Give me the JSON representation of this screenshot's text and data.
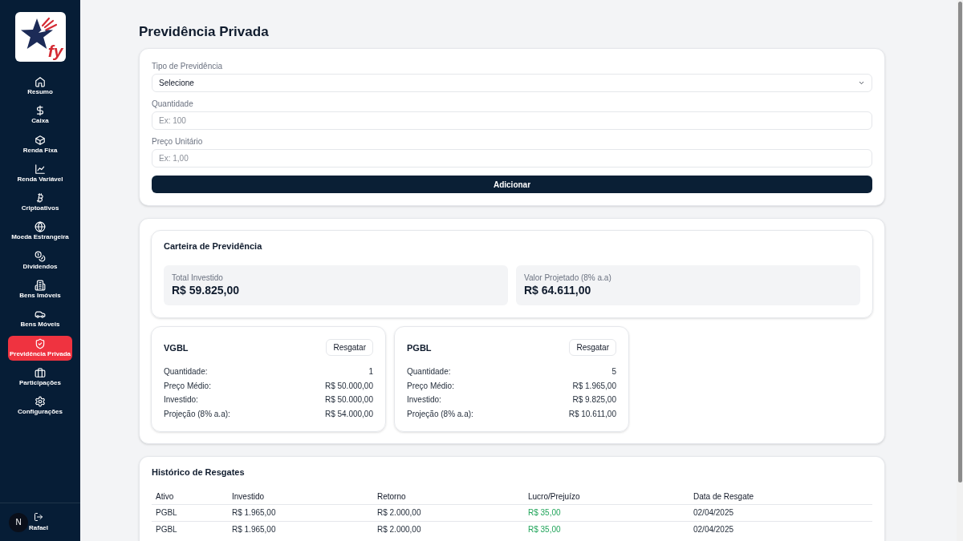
{
  "sidebar": {
    "logo": {
      "text": "fy"
    },
    "items": [
      {
        "label": "Resumo",
        "selected": false
      },
      {
        "label": "Caixa",
        "selected": false
      },
      {
        "label": "Renda Fixa",
        "selected": false
      },
      {
        "label": "Renda Variável",
        "selected": false
      },
      {
        "label": "Criptoativos",
        "selected": false
      },
      {
        "label": "Moeda Estrangeira",
        "selected": false
      },
      {
        "label": "Dividendos",
        "selected": false
      },
      {
        "label": "Bens Imóveis",
        "selected": false
      },
      {
        "label": "Bens Móveis",
        "selected": false
      },
      {
        "label": "Previdência Privada",
        "selected": true
      },
      {
        "label": "Participações",
        "selected": false
      },
      {
        "label": "Configurações",
        "selected": false
      }
    ],
    "footer": {
      "badge": "N",
      "user": "Rafael"
    }
  },
  "page": {
    "title": "Previdência Privada"
  },
  "form": {
    "fields": [
      {
        "kind": "select",
        "label": "Tipo de Previdência",
        "value": "Selecione"
      },
      {
        "kind": "input",
        "label": "Quantidade",
        "placeholder": "Ex: 100"
      },
      {
        "kind": "input",
        "label": "Preço Unitário",
        "placeholder": "Ex: 1,00"
      }
    ],
    "submit": "Adicionar"
  },
  "portfolio": {
    "title": "Carteira de Previdência",
    "stats": [
      {
        "label": "Total Investido",
        "value": "R$ 59.825,00"
      },
      {
        "label": "Valor Projetado (8% a.a)",
        "value": "R$ 64.611,00"
      }
    ],
    "plans": [
      {
        "name": "VGBL",
        "action": "Resgatar",
        "rows": [
          {
            "label": "Quantidade:",
            "value": "1"
          },
          {
            "label": "Preço Médio:",
            "value": "R$ 50.000,00"
          },
          {
            "label": "Investido:",
            "value": "R$ 50.000,00"
          },
          {
            "label": "Projeção (8% a.a):",
            "value": "R$ 54.000,00"
          }
        ]
      },
      {
        "name": "PGBL",
        "action": "Resgatar",
        "rows": [
          {
            "label": "Quantidade:",
            "value": "5"
          },
          {
            "label": "Preço Médio:",
            "value": "R$ 1.965,00"
          },
          {
            "label": "Investido:",
            "value": "R$ 9.825,00"
          },
          {
            "label": "Projeção (8% a.a):",
            "value": "R$ 10.611,00"
          }
        ]
      }
    ]
  },
  "history": {
    "title": "Histórico de Resgates",
    "columns": [
      "Ativo",
      "Investido",
      "Retorno",
      "Lucro/Prejuízo",
      "Data de Resgate"
    ],
    "rows": [
      {
        "asset": "PGBL",
        "invested": "R$ 1.965,00",
        "return": "R$ 2.000,00",
        "result": "R$ 35,00",
        "date": "02/04/2025",
        "gain": true
      },
      {
        "asset": "PGBL",
        "invested": "R$ 1.965,00",
        "return": "R$ 2.000,00",
        "result": "R$ 35,00",
        "date": "02/04/2025",
        "gain": true
      }
    ]
  }
}
